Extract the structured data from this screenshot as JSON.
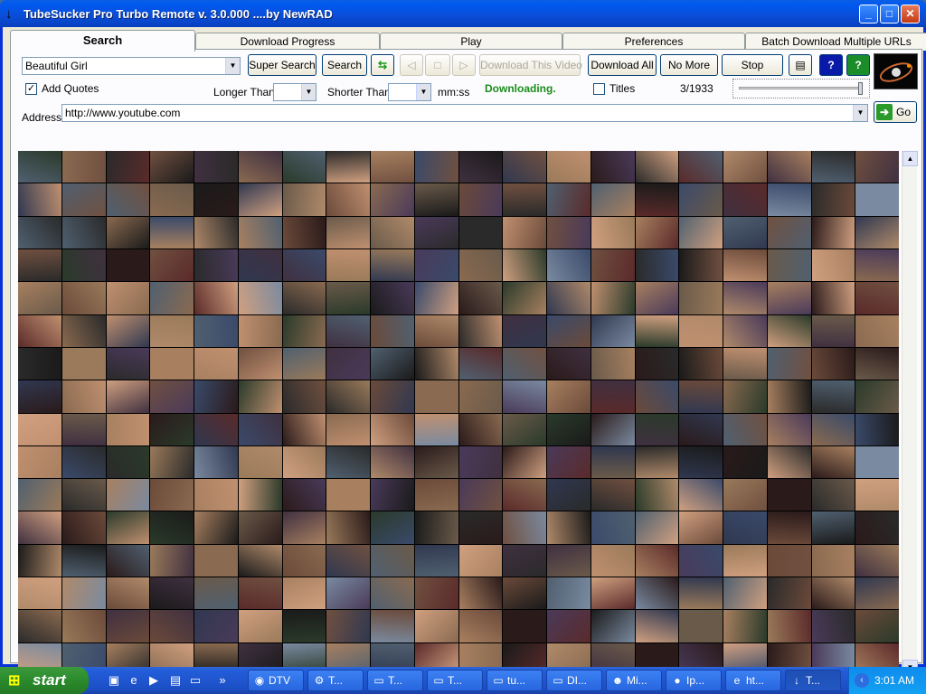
{
  "window": {
    "title": "TubeSucker Pro Turbo Remote  v. 3.0.000     ....by NewRAD"
  },
  "tabs": [
    {
      "label": "Search",
      "active": true
    },
    {
      "label": "Download Progress"
    },
    {
      "label": "Play"
    },
    {
      "label": "Preferences"
    },
    {
      "label": "Batch Download Multiple URLs"
    }
  ],
  "search": {
    "query": "Beautiful Girl",
    "super_search_label": "Super Search",
    "search_label": "Search",
    "download_video_label": "Download This Video",
    "download_all_label": "Download All",
    "no_more_label": "No More",
    "stop_label": "Stop",
    "add_quotes_label": "Add Quotes",
    "add_quotes_checked": true,
    "longer_than_label": "Longer Than",
    "longer_than_value": "",
    "shorter_than_label": "Shorter Than",
    "shorter_than_value": "",
    "unit_label": "mm:ss",
    "status_text": "Downloading.",
    "titles_label": "Titles",
    "titles_checked": false,
    "count_text": "3/1933",
    "status_color": "#1a8c1a"
  },
  "address": {
    "label": "Address",
    "value": "http://www.youtube.com",
    "go_label": "Go"
  },
  "icons": {
    "refresh": "refresh-icon",
    "back": "back-icon",
    "stop_square": "stop-icon",
    "forward": "forward-icon",
    "window": "window-icon",
    "help": "help-icon",
    "help_green": "help-green-icon",
    "logo": "satellite-logo-icon"
  },
  "thumbnails": {
    "columns": 20,
    "rows": 16
  },
  "taskbar": {
    "start_label": "start",
    "tasks": [
      {
        "label": "DTV"
      },
      {
        "label": "T..."
      },
      {
        "label": "T..."
      },
      {
        "label": "T..."
      },
      {
        "label": "tu..."
      },
      {
        "label": "DI..."
      },
      {
        "label": "Mi..."
      },
      {
        "label": "Ip..."
      },
      {
        "label": "ht..."
      },
      {
        "label": "T...",
        "active": true
      }
    ],
    "clock": "3:01 AM"
  }
}
